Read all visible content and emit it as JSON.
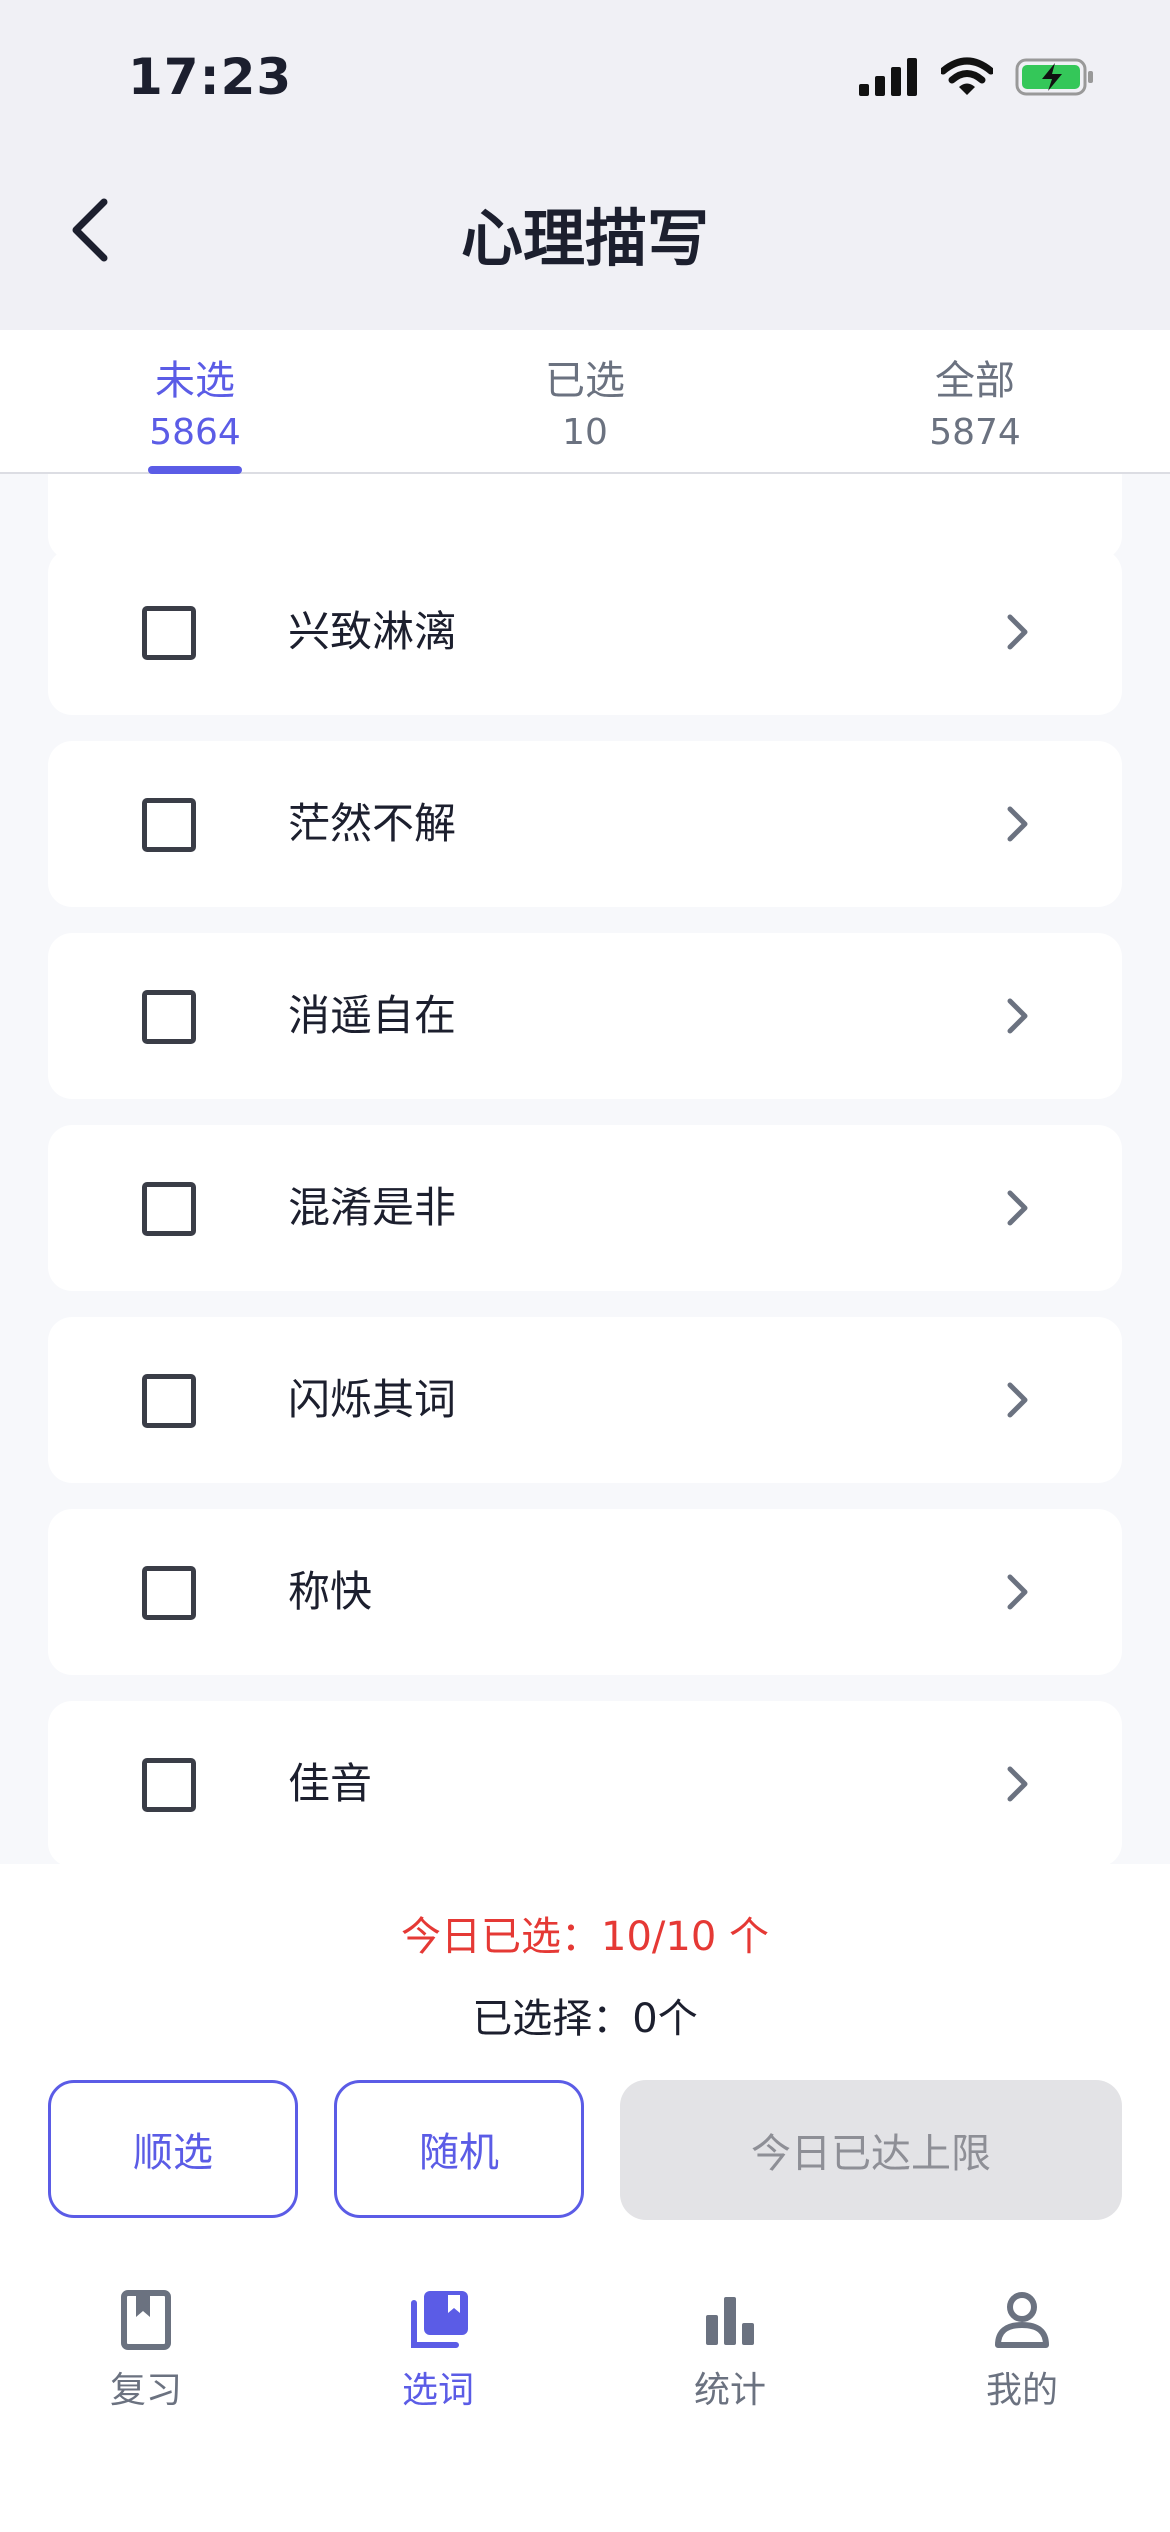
{
  "status_bar": {
    "time": "17:23",
    "icons": [
      "signal-icon",
      "wifi-icon",
      "battery-charging-icon"
    ]
  },
  "header": {
    "title": "心理描写",
    "back_icon": "chevron-left-icon"
  },
  "tabs": [
    {
      "label": "未选",
      "count": "5864",
      "active": true
    },
    {
      "label": "已选",
      "count": "10",
      "active": false
    },
    {
      "label": "全部",
      "count": "5874",
      "active": false
    }
  ],
  "words": [
    {
      "text": "兴致淋漓",
      "checked": false
    },
    {
      "text": "茫然不解",
      "checked": false
    },
    {
      "text": "消遥自在",
      "checked": false
    },
    {
      "text": "混淆是非",
      "checked": false
    },
    {
      "text": "闪烁其词",
      "checked": false
    },
    {
      "text": "称快",
      "checked": false
    },
    {
      "text": "佳音",
      "checked": false
    }
  ],
  "summary": {
    "today_selected": "今日已选：10/10 个",
    "selected": "已选择：0个"
  },
  "actions": {
    "sequential": "顺选",
    "random": "随机",
    "limit_reached": "今日已达上限"
  },
  "tab_bar": [
    {
      "label": "复习",
      "icon": "bookmark-book-icon",
      "active": false
    },
    {
      "label": "选词",
      "icon": "books-stack-icon",
      "active": true
    },
    {
      "label": "统计",
      "icon": "bar-chart-icon",
      "active": false
    },
    {
      "label": "我的",
      "icon": "person-icon",
      "active": false
    }
  ],
  "colors": {
    "accent": "#5b5ce6",
    "warning": "#e53935",
    "disabled_bg": "#e3e3e6"
  }
}
